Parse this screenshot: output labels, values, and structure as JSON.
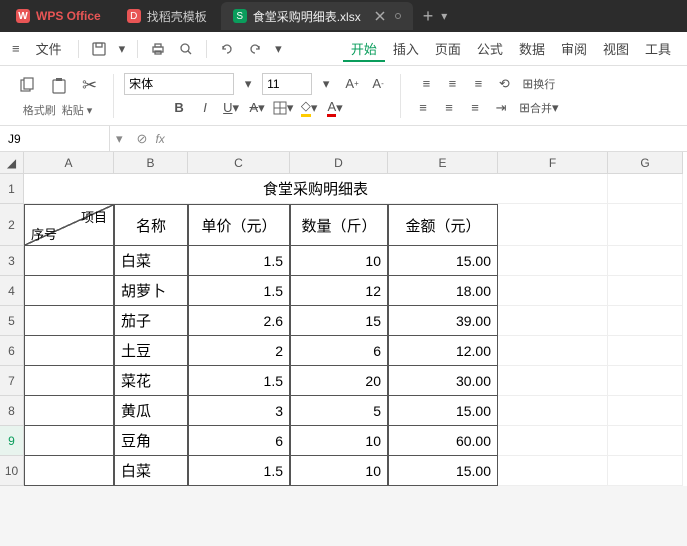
{
  "tabs": {
    "home": "WPS Office",
    "template": "找稻壳模板",
    "file": "食堂采购明细表.xlsx"
  },
  "menubar": {
    "hamburger": "≡",
    "file_menu": "文件",
    "items": [
      "开始",
      "插入",
      "页面",
      "公式",
      "数据",
      "审阅",
      "视图",
      "工具"
    ]
  },
  "ribbon": {
    "format_painter": "格式刷",
    "paste": "粘贴",
    "font_name": "宋体",
    "font_size": "11",
    "wrap": "换行",
    "merge": "合并"
  },
  "formula_bar": {
    "name_box": "J9",
    "fx": "fx",
    "formula": ""
  },
  "sheet": {
    "columns": [
      "A",
      "B",
      "C",
      "D",
      "E",
      "F",
      "G"
    ],
    "rows": [
      "1",
      "2",
      "3",
      "4",
      "5",
      "6",
      "7",
      "8",
      "9",
      "10"
    ],
    "active_row": "9",
    "title": "食堂采购明细表",
    "diag_top": "项目",
    "diag_bottom": "序号",
    "headers": [
      "名称",
      "单价（元）",
      "数量（斤）",
      "金额（元）"
    ],
    "data": [
      {
        "name": "白菜",
        "price": "1.5",
        "qty": "10",
        "amount": "15.00"
      },
      {
        "name": "胡萝卜",
        "price": "1.5",
        "qty": "12",
        "amount": "18.00"
      },
      {
        "name": "茄子",
        "price": "2.6",
        "qty": "15",
        "amount": "39.00"
      },
      {
        "name": "土豆",
        "price": "2",
        "qty": "6",
        "amount": "12.00"
      },
      {
        "name": "菜花",
        "price": "1.5",
        "qty": "20",
        "amount": "30.00"
      },
      {
        "name": "黄瓜",
        "price": "3",
        "qty": "5",
        "amount": "15.00"
      },
      {
        "name": "豆角",
        "price": "6",
        "qty": "10",
        "amount": "60.00"
      },
      {
        "name": "白菜",
        "price": "1.5",
        "qty": "10",
        "amount": "15.00"
      }
    ]
  },
  "chart_data": {
    "type": "table",
    "title": "食堂采购明细表",
    "columns": [
      "名称",
      "单价（元）",
      "数量（斤）",
      "金额（元）"
    ],
    "rows": [
      [
        "白菜",
        1.5,
        10,
        15.0
      ],
      [
        "胡萝卜",
        1.5,
        12,
        18.0
      ],
      [
        "茄子",
        2.6,
        15,
        39.0
      ],
      [
        "土豆",
        2,
        6,
        12.0
      ],
      [
        "菜花",
        1.5,
        20,
        30.0
      ],
      [
        "黄瓜",
        3,
        5,
        15.0
      ],
      [
        "豆角",
        6,
        10,
        60.0
      ],
      [
        "白菜",
        1.5,
        10,
        15.0
      ]
    ]
  }
}
